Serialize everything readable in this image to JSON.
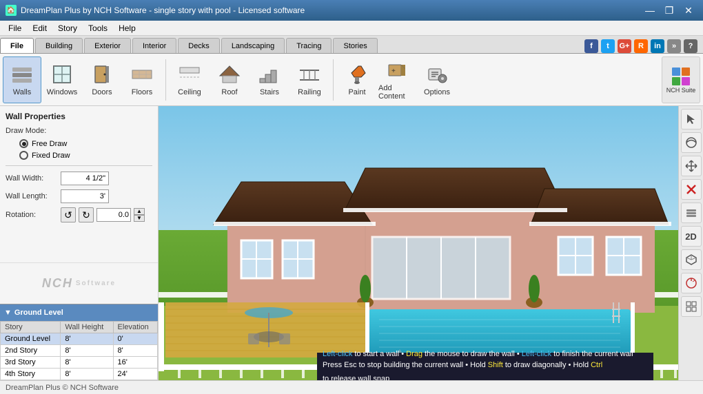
{
  "titleBar": {
    "title": "DreamPlan Plus by NCH Software - single story with pool - Licensed software",
    "icon": "🏠",
    "controls": [
      "—",
      "❐",
      "✕"
    ]
  },
  "menuBar": {
    "items": [
      "File",
      "Edit",
      "Story",
      "Tools",
      "Help"
    ]
  },
  "tabs": {
    "items": [
      "File",
      "Building",
      "Exterior",
      "Interior",
      "Decks",
      "Landscaping",
      "Tracing",
      "Stories"
    ],
    "active": "File"
  },
  "toolbar": {
    "tools": [
      {
        "id": "walls",
        "label": "Walls",
        "icon": "🧱",
        "active": true
      },
      {
        "id": "windows",
        "label": "Windows",
        "icon": "🪟",
        "active": false
      },
      {
        "id": "doors",
        "label": "Doors",
        "icon": "🚪",
        "active": false
      },
      {
        "id": "floors",
        "label": "Floors",
        "icon": "▦",
        "active": false
      },
      {
        "id": "ceiling",
        "label": "Ceiling",
        "icon": "⬜",
        "active": false
      },
      {
        "id": "roof",
        "label": "Roof",
        "icon": "🏠",
        "active": false
      },
      {
        "id": "stairs",
        "label": "Stairs",
        "icon": "𝄩",
        "active": false
      },
      {
        "id": "railing",
        "label": "Railing",
        "icon": "⊞",
        "active": false
      },
      {
        "id": "paint",
        "label": "Paint",
        "icon": "🪣",
        "active": false
      },
      {
        "id": "add_content",
        "label": "Add Content",
        "icon": "📦",
        "active": false
      },
      {
        "id": "options",
        "label": "Options",
        "icon": "⚙",
        "active": false
      }
    ],
    "nch_suite": "NCH Suite"
  },
  "wallProperties": {
    "title": "Wall Properties",
    "drawModeLabel": "Draw Mode:",
    "freeDraw": "Free Draw",
    "fixedDraw": "Fixed Draw",
    "wallWidthLabel": "Wall Width:",
    "wallWidthValue": "4 1/2\"",
    "wallLengthLabel": "Wall Length:",
    "wallLengthValue": "3'",
    "rotationLabel": "Rotation:",
    "rotationValue": "0.0"
  },
  "nchLogo": "NCH",
  "storyPanel": {
    "title": "Ground Level",
    "columns": [
      "Story",
      "Wall Height",
      "Elevation"
    ],
    "rows": [
      {
        "story": "Ground Level",
        "wallHeight": "8'",
        "elevation": "0'",
        "selected": true
      },
      {
        "story": "2nd Story",
        "wallHeight": "8'",
        "elevation": "8'"
      },
      {
        "story": "3rd Story",
        "wallHeight": "8'",
        "elevation": "16'"
      },
      {
        "story": "4th Story",
        "wallHeight": "8'",
        "elevation": "24'"
      }
    ]
  },
  "rightToolbar": {
    "tools": [
      {
        "id": "pointer",
        "icon": "☞",
        "active": false
      },
      {
        "id": "orbit",
        "icon": "↺",
        "active": false
      },
      {
        "id": "pan",
        "icon": "↕",
        "active": false
      },
      {
        "id": "delete",
        "icon": "✕",
        "active": false,
        "color": "red"
      },
      {
        "id": "layers",
        "icon": "⊡",
        "active": false
      },
      {
        "id": "2d",
        "label": "2D",
        "active": false
      },
      {
        "id": "3d",
        "icon": "◈",
        "active": false
      },
      {
        "id": "measure",
        "icon": "◉",
        "active": false
      },
      {
        "id": "grid",
        "icon": "⊞",
        "active": false
      }
    ]
  },
  "instructions": {
    "line1_parts": [
      {
        "text": "Left-click",
        "color": "blue"
      },
      {
        "text": " to start a wall • ",
        "color": "white"
      },
      {
        "text": "Drag",
        "color": "yellow"
      },
      {
        "text": " the mouse to draw the wall • ",
        "color": "white"
      },
      {
        "text": "Left-click",
        "color": "blue"
      },
      {
        "text": " to finish the current wall",
        "color": "white"
      }
    ],
    "line2_parts": [
      {
        "text": "Press Esc to stop building the current wall • Hold ",
        "color": "white"
      },
      {
        "text": "Shift",
        "color": "yellow"
      },
      {
        "text": " to draw diagonally • Hold ",
        "color": "white"
      },
      {
        "text": "Ctrl",
        "color": "yellow"
      },
      {
        "text": " to release wall snap",
        "color": "white"
      }
    ]
  },
  "statusBar": {
    "text": "DreamPlan Plus © NCH Software"
  }
}
